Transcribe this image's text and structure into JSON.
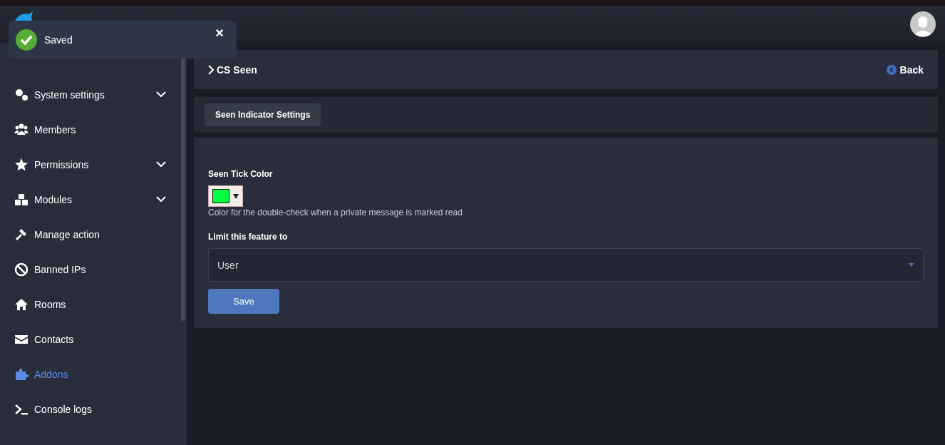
{
  "toast": {
    "message": "Saved",
    "close": "×"
  },
  "sidebar": {
    "items": [
      {
        "label": "System settings",
        "expandable": true,
        "selected": false
      },
      {
        "label": "Members",
        "expandable": false,
        "selected": false
      },
      {
        "label": "Permissions",
        "expandable": true,
        "selected": false
      },
      {
        "label": "Modules",
        "expandable": true,
        "selected": false
      },
      {
        "label": "Manage action",
        "expandable": false,
        "selected": false
      },
      {
        "label": "Banned IPs",
        "expandable": false,
        "selected": false
      },
      {
        "label": "Rooms",
        "expandable": false,
        "selected": false
      },
      {
        "label": "Contacts",
        "expandable": false,
        "selected": false
      },
      {
        "label": "Addons",
        "expandable": false,
        "selected": true
      },
      {
        "label": "Console logs",
        "expandable": false,
        "selected": false
      }
    ]
  },
  "page": {
    "title": "CS Seen",
    "back": "Back"
  },
  "tabs": [
    {
      "label": "Seen Indicator Settings",
      "selected": true
    }
  ],
  "form": {
    "color_label": "Seen Tick Color",
    "color": "#00ff40",
    "color_help": "Color for the double-check when a private message is marked read",
    "limit_label": "Limit this feature to",
    "limit_value": "User",
    "save": "Save"
  }
}
